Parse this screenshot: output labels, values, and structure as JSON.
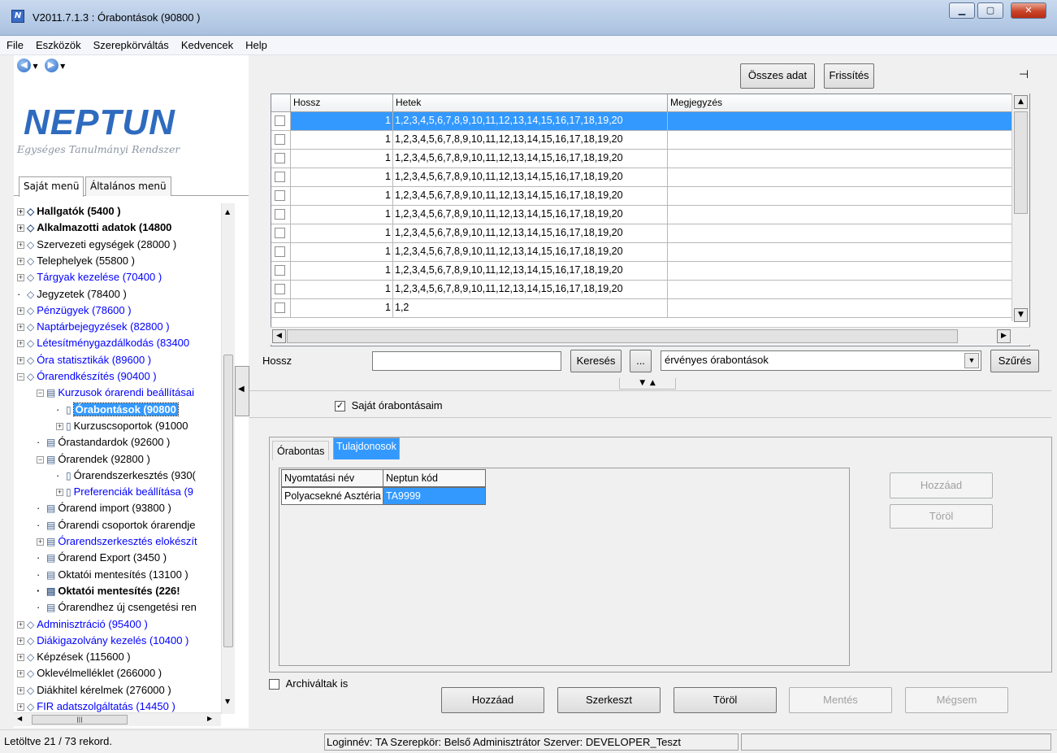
{
  "window": {
    "title": "V2011.7.1.3 : Órabontások (90800  )",
    "app_icon": "N"
  },
  "menubar": [
    "File",
    "Eszközök",
    "Szerepkörváltás",
    "Kedvencek",
    "Help"
  ],
  "logo": {
    "name": "NEPTUN",
    "subtitle": "Egységes Tanulmányi Rendszer"
  },
  "left_tabs": [
    "Saját menü",
    "Általános menü"
  ],
  "tree": [
    {
      "label": "Hallgatók (5400  )",
      "bold": true,
      "level": 0,
      "pm": "+",
      "icon": "diamond"
    },
    {
      "label": "Alkalmazotti adatok (14800",
      "bold": true,
      "level": 0,
      "pm": "+",
      "icon": "diamond"
    },
    {
      "label": "Szervezeti egységek (28000  )",
      "level": 0,
      "pm": "+",
      "icon": "diamond"
    },
    {
      "label": "Telephelyek (55800  )",
      "level": 0,
      "pm": "+",
      "icon": "diamond"
    },
    {
      "label": "Tárgyak kezelése (70400  )",
      "blue": true,
      "level": 0,
      "pm": "+",
      "icon": "diamond"
    },
    {
      "label": "Jegyzetek (78400  )",
      "level": 0,
      "pm": "",
      "icon": "diamond"
    },
    {
      "label": "Pénzügyek (78600  )",
      "blue": true,
      "level": 0,
      "pm": "+",
      "icon": "diamond"
    },
    {
      "label": "Naptárbejegyzések (82800  )",
      "blue": true,
      "level": 0,
      "pm": "+",
      "icon": "diamond"
    },
    {
      "label": "Létesítménygazdálkodás (83400",
      "blue": true,
      "level": 0,
      "pm": "+",
      "icon": "diamond"
    },
    {
      "label": "Óra statisztikák (89600  )",
      "blue": true,
      "level": 0,
      "pm": "+",
      "icon": "diamond"
    },
    {
      "label": "Órarendkészítés (90400  )",
      "blue": true,
      "level": 0,
      "pm": "-",
      "icon": "diamond"
    },
    {
      "label": "Kurzusok órarendi beállításai",
      "blue": true,
      "level": 1,
      "pm": "-",
      "icon": "folder"
    },
    {
      "label": "Órabontások (90800",
      "selected": true,
      "level": 2,
      "pm": "",
      "icon": "page"
    },
    {
      "label": "Kurzuscsoportok (91000",
      "level": 2,
      "pm": "+",
      "icon": "page"
    },
    {
      "label": "Órastandardok (92600  )",
      "level": 1,
      "pm": "",
      "icon": "folder"
    },
    {
      "label": "Órarendek (92800  )",
      "level": 1,
      "pm": "-",
      "icon": "folder"
    },
    {
      "label": "Órarendszerkesztés (930(",
      "level": 2,
      "pm": "",
      "icon": "page"
    },
    {
      "label": "Preferenciák beállítása (9",
      "blue": true,
      "level": 2,
      "pm": "+",
      "icon": "page"
    },
    {
      "label": "Órarend import (93800  )",
      "level": 1,
      "pm": "",
      "icon": "folder"
    },
    {
      "label": "Órarendi csoportok órarendje",
      "level": 1,
      "pm": "",
      "icon": "folder"
    },
    {
      "label": "Órarendszerkesztés elokészít",
      "blue": true,
      "level": 1,
      "pm": "+",
      "icon": "folder"
    },
    {
      "label": "Órarend Export (3450  )",
      "level": 1,
      "pm": "",
      "icon": "folder"
    },
    {
      "label": "Oktatói mentesítés (13100  )",
      "level": 1,
      "pm": "",
      "icon": "folder"
    },
    {
      "label": "Oktatói mentesítés (226!",
      "bold": true,
      "level": 1,
      "pm": "",
      "icon": "folder"
    },
    {
      "label": "Órarendhez új csengetési ren",
      "level": 1,
      "pm": "",
      "icon": "folder"
    },
    {
      "label": "Adminisztráció (95400  )",
      "blue": true,
      "level": 0,
      "pm": "+",
      "icon": "diamond"
    },
    {
      "label": "Diákigazolvány kezelés (10400  )",
      "blue": true,
      "level": 0,
      "pm": "+",
      "icon": "diamond"
    },
    {
      "label": "Képzések (115600  )",
      "level": 0,
      "pm": "+",
      "icon": "diamond"
    },
    {
      "label": "Oklevélmelléklet (266000  )",
      "level": 0,
      "pm": "+",
      "icon": "diamond"
    },
    {
      "label": "Diákhitel kérelmek (276000  )",
      "level": 0,
      "pm": "+",
      "icon": "diamond"
    },
    {
      "label": "FIR adatszolgáltatás (14450  )",
      "blue": true,
      "level": 0,
      "pm": "+",
      "icon": "diamond"
    }
  ],
  "toolbar": {
    "all_data": "Összes adat",
    "refresh": "Frissítés"
  },
  "grid": {
    "columns": [
      "Hossz",
      "Hetek",
      "Megjegyzés"
    ],
    "rows": [
      {
        "hossz": "1",
        "hetek": "1,2,3,4,5,6,7,8,9,10,11,12,13,14,15,16,17,18,19,20",
        "megj": "",
        "selected": true
      },
      {
        "hossz": "1",
        "hetek": "1,2,3,4,5,6,7,8,9,10,11,12,13,14,15,16,17,18,19,20",
        "megj": ""
      },
      {
        "hossz": "1",
        "hetek": "1,2,3,4,5,6,7,8,9,10,11,12,13,14,15,16,17,18,19,20",
        "megj": ""
      },
      {
        "hossz": "1",
        "hetek": "1,2,3,4,5,6,7,8,9,10,11,12,13,14,15,16,17,18,19,20",
        "megj": ""
      },
      {
        "hossz": "1",
        "hetek": "1,2,3,4,5,6,7,8,9,10,11,12,13,14,15,16,17,18,19,20",
        "megj": ""
      },
      {
        "hossz": "1",
        "hetek": "1,2,3,4,5,6,7,8,9,10,11,12,13,14,15,16,17,18,19,20",
        "megj": ""
      },
      {
        "hossz": "1",
        "hetek": "1,2,3,4,5,6,7,8,9,10,11,12,13,14,15,16,17,18,19,20",
        "megj": ""
      },
      {
        "hossz": "1",
        "hetek": "1,2,3,4,5,6,7,8,9,10,11,12,13,14,15,16,17,18,19,20",
        "megj": ""
      },
      {
        "hossz": "1",
        "hetek": "1,2,3,4,5,6,7,8,9,10,11,12,13,14,15,16,17,18,19,20",
        "megj": ""
      },
      {
        "hossz": "1",
        "hetek": "1,2,3,4,5,6,7,8,9,10,11,12,13,14,15,16,17,18,19,20",
        "megj": ""
      },
      {
        "hossz": "1",
        "hetek": "1,2",
        "megj": ""
      }
    ]
  },
  "search": {
    "label": "Hossz",
    "value": "",
    "button": "Keresés",
    "ellipsis": "...",
    "filter_value": "érvényes órabontások",
    "filter_button": "Szűrés"
  },
  "own_only": {
    "label": "Saját órabontásaim",
    "checked": true
  },
  "detail_tabs": [
    "Órabontas",
    "Tulajdonosok"
  ],
  "owners": {
    "columns": [
      "Nyomtatási név",
      "Neptun kód"
    ],
    "rows": [
      {
        "name": "Polyacsekné Asztéria",
        "code": "TA9999"
      }
    ],
    "add": "Hozzáad",
    "delete": "Töröl"
  },
  "archived": {
    "label": "Archiváltak is",
    "checked": false
  },
  "bottom_buttons": {
    "add": "Hozzáad",
    "edit": "Szerkeszt",
    "delete": "Töröl",
    "save": "Mentés",
    "cancel": "Mégsem"
  },
  "status": {
    "records": "Letöltve 21 / 73 rekord.",
    "login": "Loginnév: TA  Szerepkör: Belső Adminisztrátor  Szerver: DEVELOPER_Teszt"
  }
}
